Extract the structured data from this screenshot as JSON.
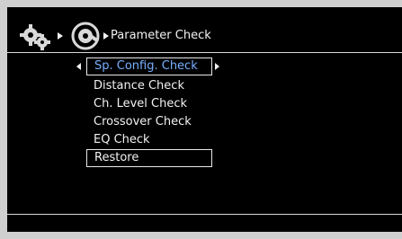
{
  "header": {
    "icons": [
      "gear-icon",
      "test-icon"
    ],
    "title": "Parameter Check"
  },
  "menu": {
    "items": [
      {
        "label": "Sp. Config. Check",
        "state": "selected"
      },
      {
        "label": "Distance Check"
      },
      {
        "label": "Ch. Level Check"
      },
      {
        "label": "Crossover Check"
      },
      {
        "label": "EQ Check"
      },
      {
        "label": "Restore",
        "state": "boxed"
      }
    ]
  },
  "colors": {
    "background": "#000000",
    "text": "#f2f2f2",
    "selected_text": "#78b0ff",
    "rule": "#d8d8d8"
  }
}
